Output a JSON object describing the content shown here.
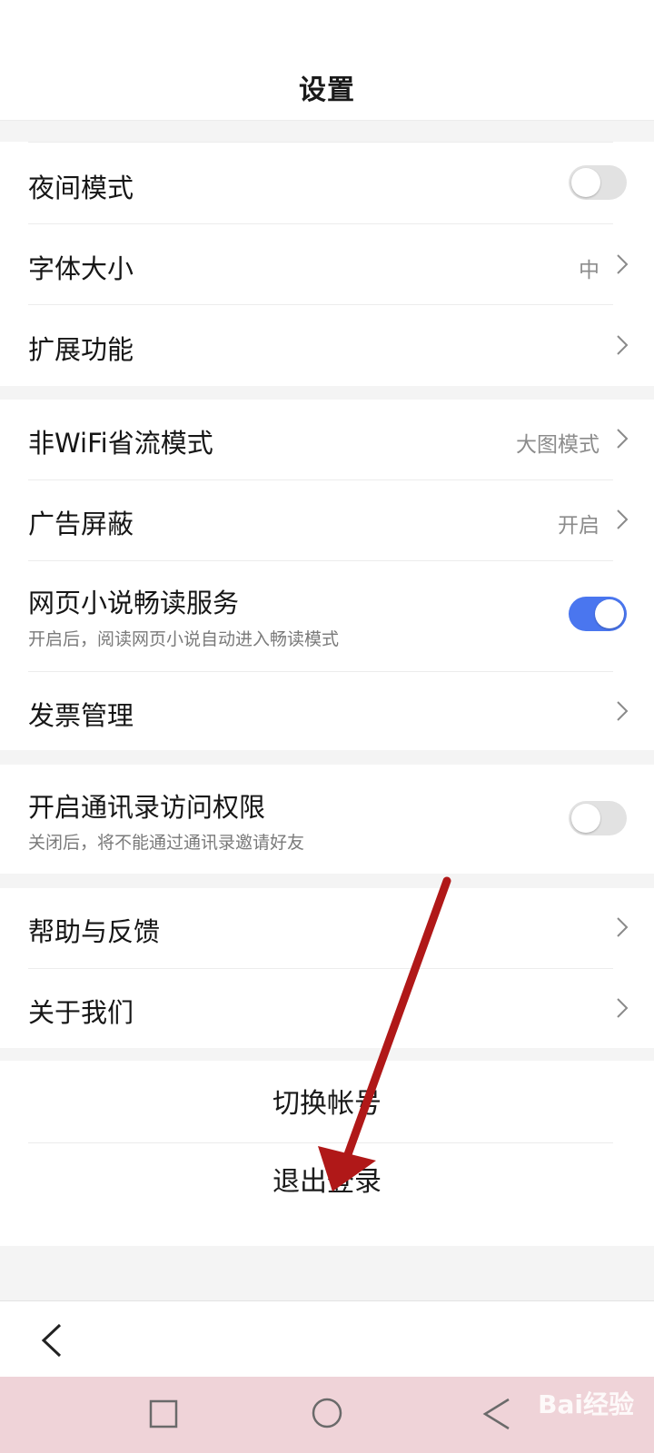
{
  "header": {
    "title": "设置"
  },
  "settings": {
    "night_mode": {
      "label": "夜间模式",
      "enabled": false
    },
    "font_size": {
      "label": "字体大小",
      "value": "中"
    },
    "extensions": {
      "label": "扩展功能"
    },
    "non_wifi_mode": {
      "label": "非WiFi省流模式",
      "value": "大图模式"
    },
    "ad_block": {
      "label": "广告屏蔽",
      "value": "开启"
    },
    "novel_reading": {
      "label": "网页小说畅读服务",
      "sublabel": "开启后，阅读网页小说自动进入畅读模式",
      "enabled": true
    },
    "invoice": {
      "label": "发票管理"
    },
    "contacts_access": {
      "label": "开启通讯录访问权限",
      "sublabel": "关闭后，将不能通过通讯录邀请好友",
      "enabled": false
    },
    "help_feedback": {
      "label": "帮助与反馈"
    },
    "about_us": {
      "label": "关于我们"
    }
  },
  "account": {
    "switch_account": "切换帐号",
    "logout": "退出登录"
  },
  "watermark": {
    "text": "Bai经验"
  },
  "colors": {
    "accent": "#4a76ef",
    "annotation_arrow": "#b01818",
    "nav_bar": "#efd3d8"
  },
  "icons": [
    "chevron-right-icon",
    "back-arrow-icon",
    "recents-square-icon",
    "home-circle-icon",
    "system-back-triangle-icon",
    "annotation-arrow"
  ]
}
